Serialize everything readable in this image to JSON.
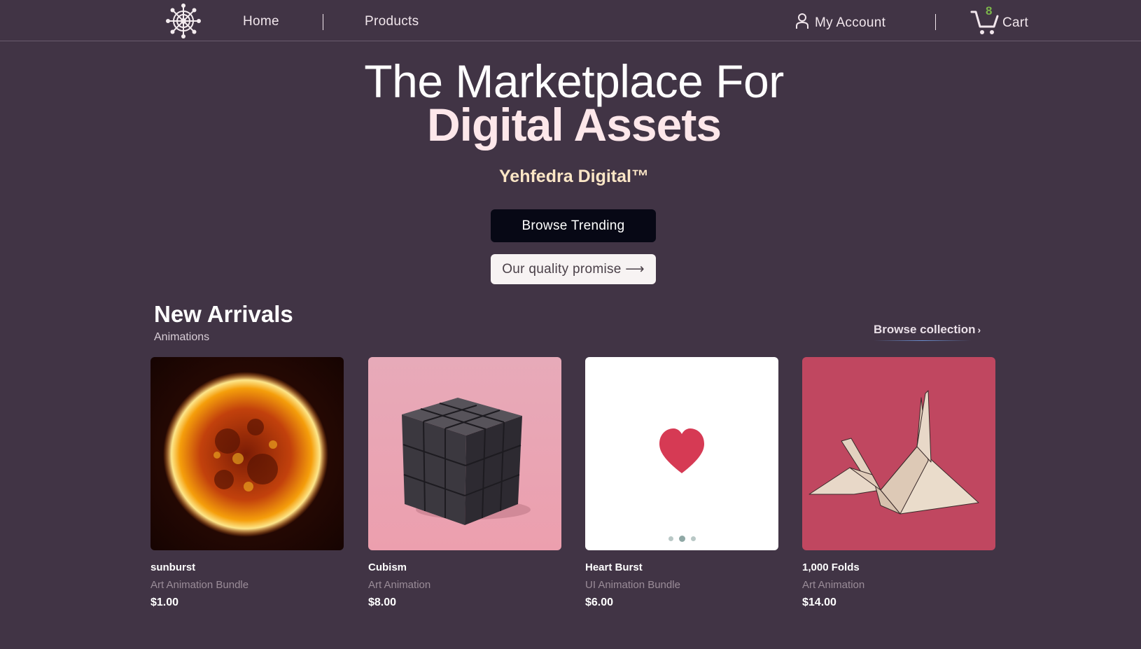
{
  "nav": {
    "home": "Home",
    "products": "Products",
    "account": "My Account",
    "cart_label": "Cart",
    "cart_count": "8"
  },
  "hero": {
    "line1": "The Marketplace For",
    "line2": "Digital Assets",
    "brand": "Yehfedra Digital™",
    "primary_button": "Browse Trending",
    "secondary_button": "Our quality promise ⟶"
  },
  "new_arrivals": {
    "title": "New Arrivals",
    "subtitle": "Animations",
    "browse_link": "Browse collection",
    "browse_chevron": "›",
    "products": [
      {
        "name": "sunburst",
        "category": "Art Animation Bundle",
        "price": "$1.00",
        "image": "sun-image"
      },
      {
        "name": "Cubism",
        "category": "Art Animation",
        "price": "$8.00",
        "image": "cube-image"
      },
      {
        "name": "Heart Burst",
        "category": "UI Animation Bundle",
        "price": "$6.00",
        "image": "heart-image"
      },
      {
        "name": "1,000 Folds",
        "category": "Art Animation",
        "price": "$14.00",
        "image": "origami-crane-image"
      }
    ]
  },
  "colors": {
    "background": "#413445",
    "primary_button": "#070815",
    "accent_text": "#fde7ea",
    "brand_text": "#fbe6c6",
    "cart_count": "#7bb54a"
  },
  "icons": [
    "dharma-wheel-logo",
    "user-icon",
    "cart-icon"
  ]
}
